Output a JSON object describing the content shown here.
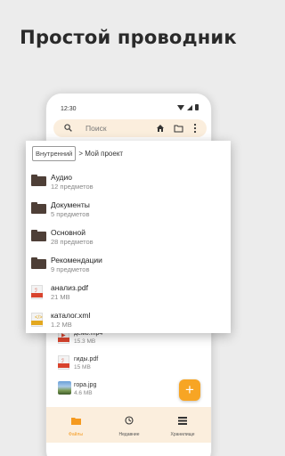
{
  "headline": "Простой проводник",
  "status": {
    "time": "12:30"
  },
  "search": {
    "placeholder": "Поиск"
  },
  "breadcrumb": {
    "storage": "Внутренний",
    "path": "> Мой проект"
  },
  "card_items": [
    {
      "name": "Аудио",
      "meta": "12 предметов",
      "icon": "folder-icon"
    },
    {
      "name": "Документы",
      "meta": "5 предметов",
      "icon": "folder-icon"
    },
    {
      "name": "Основной",
      "meta": "28 предметов",
      "icon": "folder-icon"
    },
    {
      "name": "Рекомендации",
      "meta": "9 предметов",
      "icon": "folder-icon"
    },
    {
      "name": "анализ.pdf",
      "meta": "21 MB",
      "icon": "pdf-icon"
    },
    {
      "name": "каталог.xml",
      "meta": "1.2 MB",
      "icon": "xml-icon"
    }
  ],
  "lower_items": [
    {
      "name": "демо.mp4",
      "meta": "15.3 MB",
      "icon": "video-icon"
    },
    {
      "name": "гиды.pdf",
      "meta": "15 MB",
      "icon": "pdf-icon"
    },
    {
      "name": "гора.jpg",
      "meta": "4.6 MB",
      "icon": "image-icon"
    }
  ],
  "fab": {
    "label": "+"
  },
  "nav": [
    {
      "label": "Файлы",
      "icon": "folder-icon",
      "active": true
    },
    {
      "label": "Недавние",
      "icon": "clock-icon",
      "active": false
    },
    {
      "label": "Хранилище",
      "icon": "list-icon",
      "active": false
    }
  ],
  "colors": {
    "accent": "#f7a524",
    "tint": "#fbeedd",
    "folder": "#4e3f37",
    "pdf": "#d8432d",
    "xml": "#e3a81f"
  }
}
